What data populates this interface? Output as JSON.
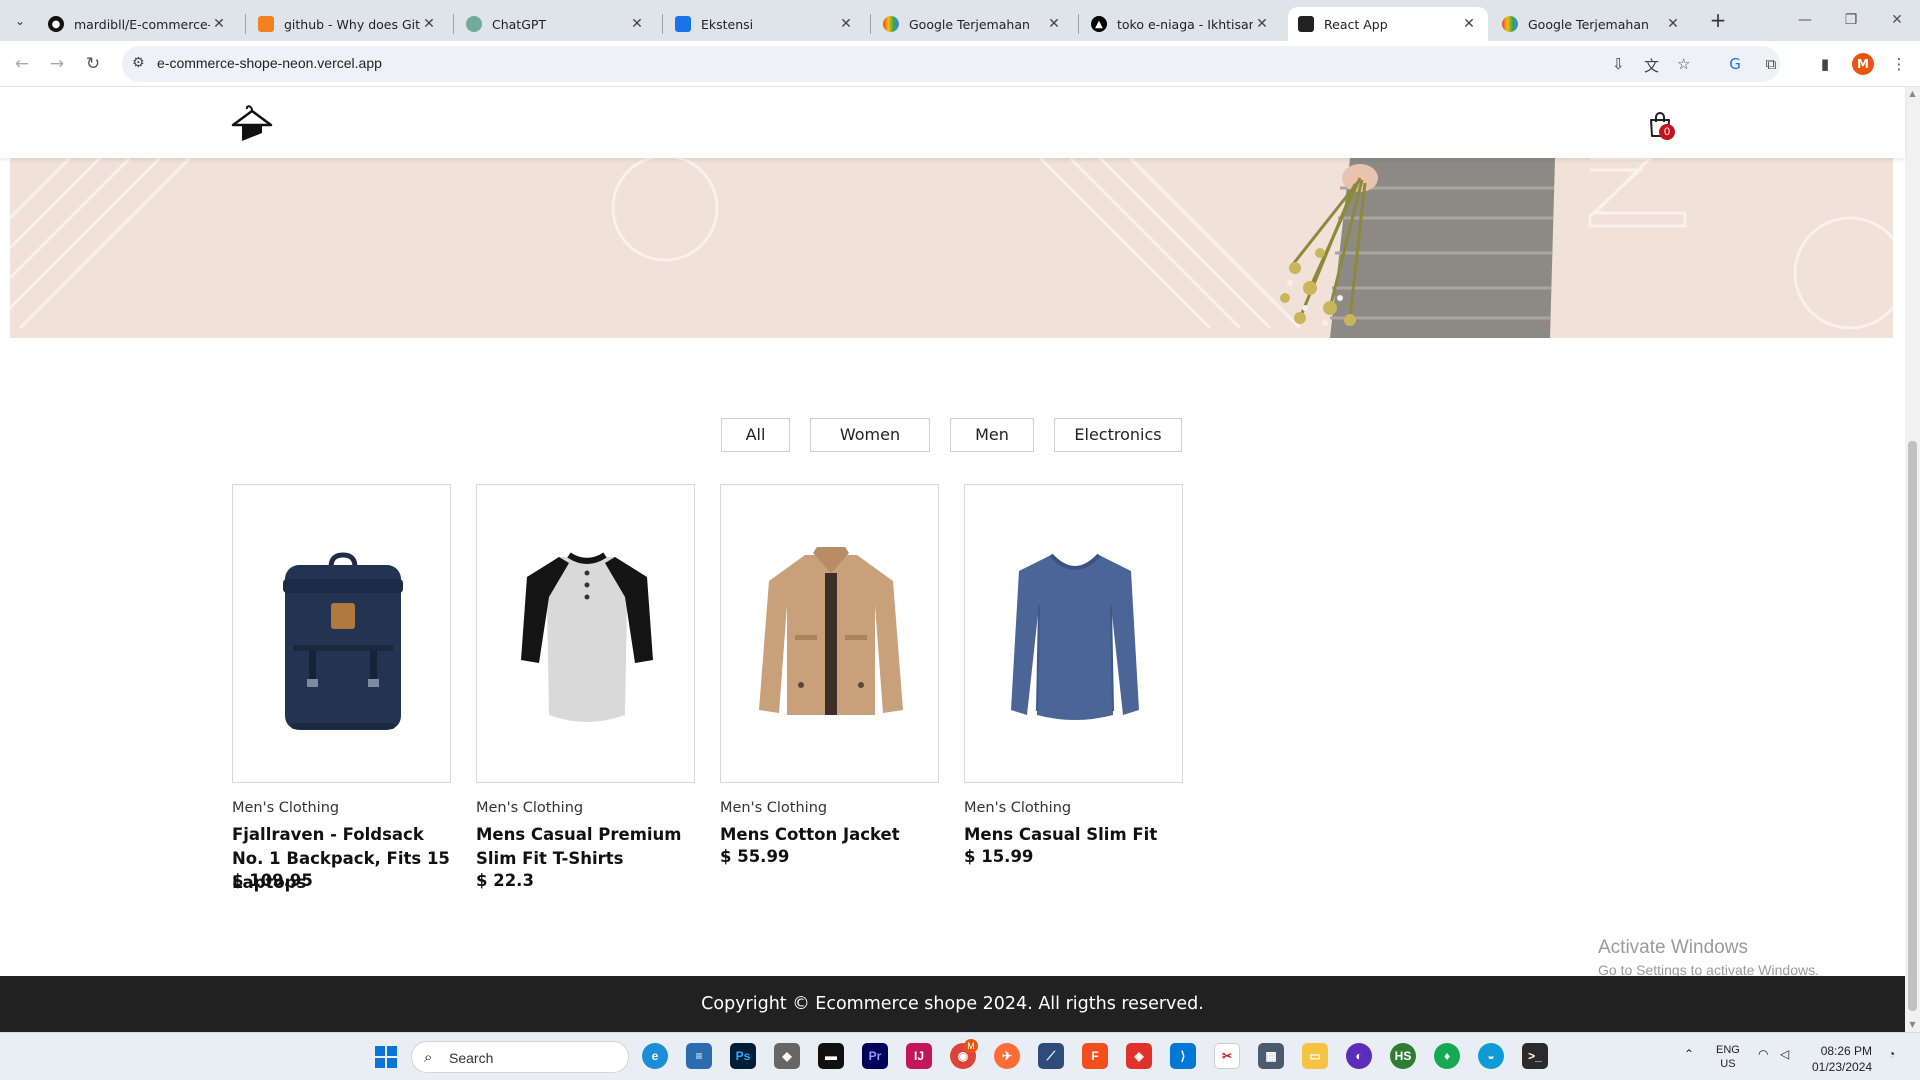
{
  "browser": {
    "tabs": [
      {
        "title": "mardibll/E-commerce-Sh",
        "icon": "github-icon"
      },
      {
        "title": "github - Why does Git tel",
        "icon": "stackoverflow-icon"
      },
      {
        "title": "ChatGPT",
        "icon": "chatgpt-icon"
      },
      {
        "title": "Ekstensi",
        "icon": "puzzle-icon"
      },
      {
        "title": "Google Terjemahan",
        "icon": "google-translate-icon"
      },
      {
        "title": "toko e-niaga - Ikhtisar - V",
        "icon": "vercel-icon"
      },
      {
        "title": "React App",
        "icon": "react-icon",
        "active": true
      },
      {
        "title": "Google Terjemahan",
        "icon": "google-translate-icon"
      }
    ],
    "url": "e-commerce-shope-neon.vercel.app",
    "profile_initial": "M"
  },
  "site": {
    "cart_count": "0",
    "filters": [
      "All",
      "Women",
      "Men",
      "Electronics"
    ],
    "products": [
      {
        "category": "Men's Clothing",
        "title": "Fjallraven - Foldsack No. 1 Backpack, Fits 15 Laptops",
        "price": "$ 109.95",
        "image": "backpack"
      },
      {
        "category": "Men's Clothing",
        "title": "Mens Casual Premium Slim Fit T-Shirts",
        "price": "$ 22.3",
        "image": "raglan-tshirt"
      },
      {
        "category": "Men's Clothing",
        "title": "Mens Cotton Jacket",
        "price": "$ 55.99",
        "image": "cotton-jacket"
      },
      {
        "category": "Men's Clothing",
        "title": "Mens Casual Slim Fit",
        "price": "$ 15.99",
        "image": "long-sleeve-shirt"
      }
    ],
    "footer": "Copyright © Ecommerce shope 2024. All rigths reserved."
  },
  "watermark": {
    "line1": "Activate Windows",
    "line2": "Go to Settings to activate Windows."
  },
  "taskbar": {
    "search_placeholder": "Search",
    "language": "ENG",
    "region": "US",
    "time": "08:26 PM",
    "date": "01/23/2024",
    "chrome_badge": "M"
  }
}
